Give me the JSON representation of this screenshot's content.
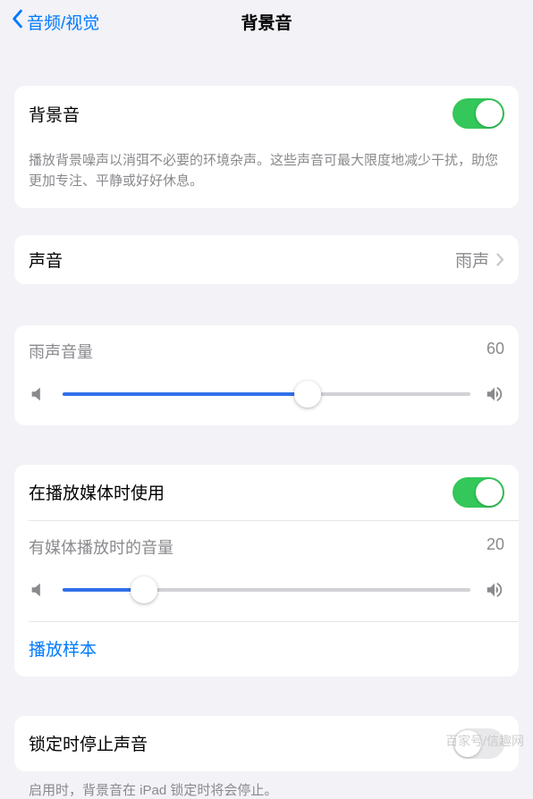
{
  "nav": {
    "back_label": "音频/视觉",
    "title": "背景音"
  },
  "group1": {
    "toggle_label": "背景音",
    "toggle_on": true,
    "description": "播放背景噪声以消弭不必要的环境杂声。这些声音可最大限度地减少干扰，助您更加专注、平静或好好休息。"
  },
  "group2": {
    "label": "声音",
    "value": "雨声"
  },
  "group3": {
    "slider_label": "雨声音量",
    "slider_value": 60
  },
  "group4": {
    "toggle_label": "在播放媒体时使用",
    "toggle_on": true,
    "slider_label": "有媒体播放时的音量",
    "slider_value": 20,
    "link_label": "播放样本"
  },
  "group5": {
    "toggle_label": "锁定时停止声音",
    "toggle_on": false,
    "footer": "启用时，背景音在 iPad 锁定时将会停止。"
  },
  "watermark": "百家号/信趣网"
}
